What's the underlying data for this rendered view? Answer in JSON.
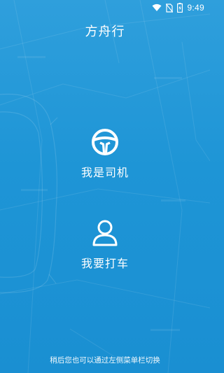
{
  "status_bar": {
    "time": "9:49"
  },
  "header": {
    "title": "方舟行"
  },
  "roles": {
    "driver": {
      "label": "我是司机",
      "icon": "steering-wheel-icon"
    },
    "passenger": {
      "label": "我要打车",
      "icon": "user-icon"
    }
  },
  "footer": {
    "hint": "稍后您也可以通过左侧菜单栏切换"
  },
  "colors": {
    "background": "#1e95d6",
    "foreground": "#ffffff"
  }
}
